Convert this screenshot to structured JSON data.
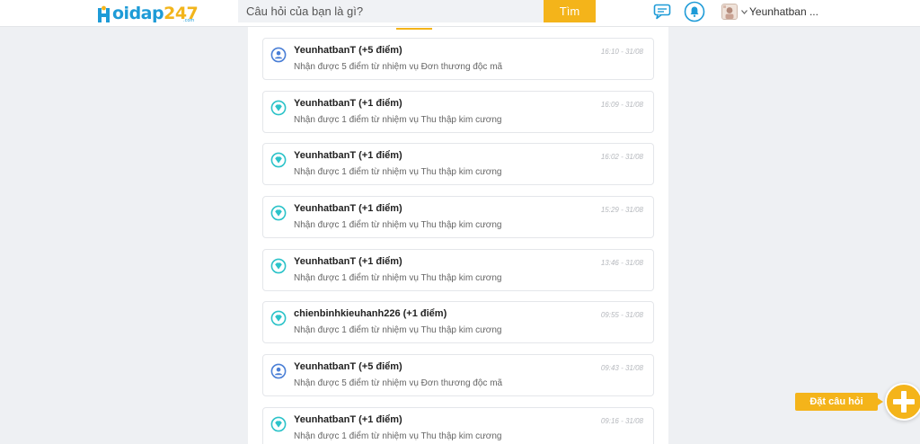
{
  "header": {
    "logo_letters": "oidap",
    "logo_number": "247",
    "logo_sub": ".com",
    "search_placeholder": "Câu hỏi của bạn là gì?",
    "search_button": "Tìm",
    "username": "Yeunhatban ..."
  },
  "colors": {
    "accent": "#f4b41a",
    "brand_blue": "#1e9bd7",
    "task_icon": "#4a7fd6",
    "diamond_icon": "#2cc3c9"
  },
  "notifications": [
    {
      "icon": "person-icon",
      "title": "YeunhatbanT (+5 điểm)",
      "desc": "Nhận được 5 điểm từ nhiệm vụ Đơn thương độc mã",
      "time": "16:10 - 31/08"
    },
    {
      "icon": "diamond-icon",
      "title": "YeunhatbanT (+1 điểm)",
      "desc": "Nhận được 1 điểm từ nhiệm vụ Thu thập kim cương",
      "time": "16:09 - 31/08"
    },
    {
      "icon": "diamond-icon",
      "title": "YeunhatbanT (+1 điểm)",
      "desc": "Nhận được 1 điểm từ nhiệm vụ Thu thập kim cương",
      "time": "16:02 - 31/08"
    },
    {
      "icon": "diamond-icon",
      "title": "YeunhatbanT (+1 điểm)",
      "desc": "Nhận được 1 điểm từ nhiệm vụ Thu thập kim cương",
      "time": "15:29 - 31/08"
    },
    {
      "icon": "diamond-icon",
      "title": "YeunhatbanT (+1 điểm)",
      "desc": "Nhận được 1 điểm từ nhiệm vụ Thu thập kim cương",
      "time": "13:46 - 31/08"
    },
    {
      "icon": "diamond-icon",
      "title": "chienbinhkieuhanh226 (+1 điểm)",
      "desc": "Nhận được 1 điểm từ nhiệm vụ Thu thập kim cương",
      "time": "09:55 - 31/08"
    },
    {
      "icon": "person-icon",
      "title": "YeunhatbanT (+5 điểm)",
      "desc": "Nhận được 5 điểm từ nhiệm vụ Đơn thương độc mã",
      "time": "09:43 - 31/08"
    },
    {
      "icon": "diamond-icon",
      "title": "YeunhatbanT (+1 điểm)",
      "desc": "Nhận được 1 điểm từ nhiệm vụ Thu thập kim cương",
      "time": "09:16 - 31/08"
    }
  ],
  "fab": {
    "label": "Đặt câu hỏi",
    "icon": "plus-icon"
  }
}
